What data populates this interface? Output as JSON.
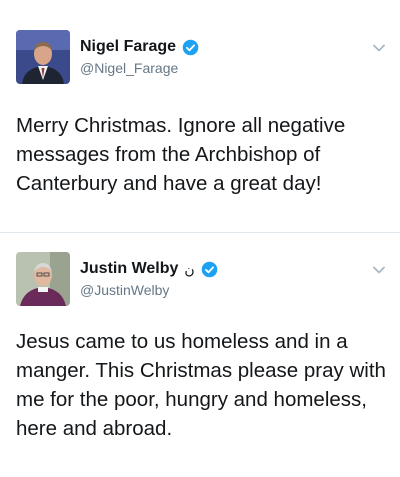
{
  "tweets": [
    {
      "display_name": "Nigel Farage",
      "name_suffix": "",
      "handle": "@Nigel_Farage",
      "text": "Merry Christmas. Ignore all negative messages from the Archbishop of Canterbury and have a great day!",
      "verified": true,
      "avatar_icon": "avatar-photo-man-suit"
    },
    {
      "display_name": "Justin Welby",
      "name_suffix": "ن",
      "handle": "@JustinWelby",
      "text": "Jesus came to us homeless and in a manger. This Christmas please pray with me for the poor, hungry and homeless, here and abroad.",
      "verified": true,
      "avatar_icon": "avatar-photo-clergy"
    }
  ],
  "colors": {
    "verified_blue": "#1da1f2",
    "handle_gray": "#657786",
    "text_dark": "#14171a",
    "chevron_gray": "#aab8c2"
  }
}
